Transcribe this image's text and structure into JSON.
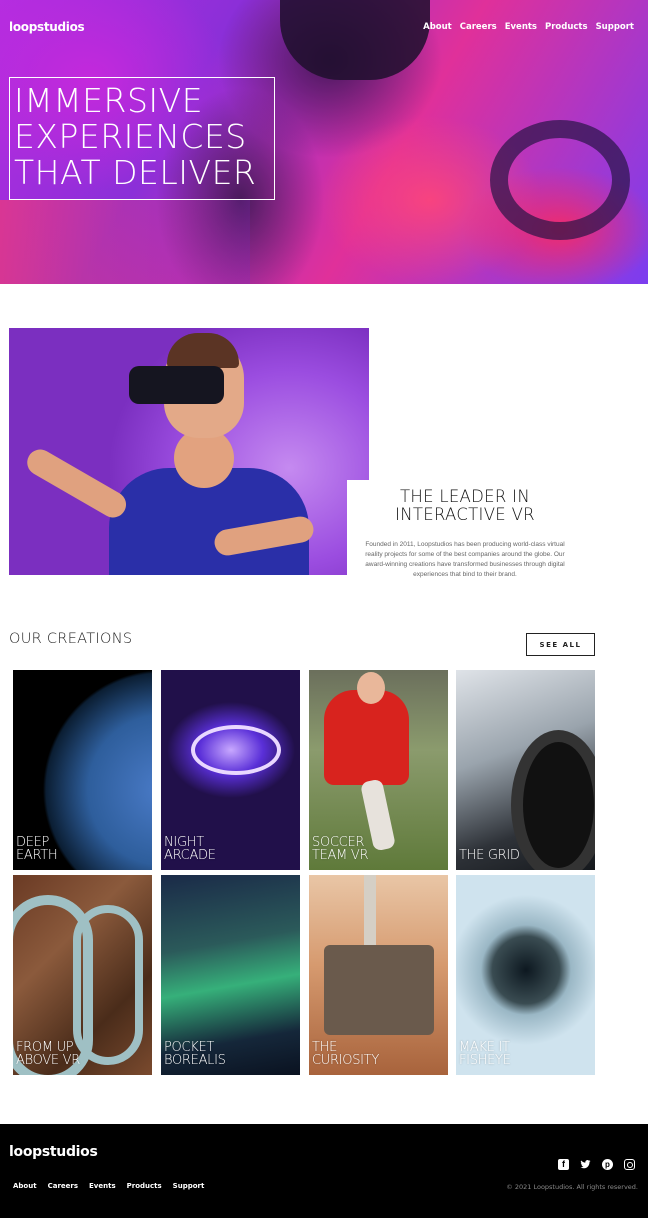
{
  "brand": {
    "logo": "loopstudios"
  },
  "nav": [
    "About",
    "Careers",
    "Events",
    "Products",
    "Support"
  ],
  "hero": {
    "title": "IMMERSIVE\nEXPERIENCES\nTHAT DELIVER"
  },
  "intro": {
    "heading": "THE LEADER IN\nINTERACTIVE VR",
    "text": "Founded in 2011, Loopstudios has been producing world-class virtual reality projects for some of the best companies around the globe. Our award-winning creations have transformed businesses through digital experiences that bind to their brand."
  },
  "creations": {
    "title": "OUR CREATIONS",
    "see_all": "SEE ALL",
    "items": [
      {
        "label": "DEEP\nEARTH"
      },
      {
        "label": "NIGHT\nARCADE"
      },
      {
        "label": "SOCCER\nTEAM VR"
      },
      {
        "label": "THE GRID"
      },
      {
        "label": "FROM UP\nABOVE VR"
      },
      {
        "label": "POCKET\nBOREALIS"
      },
      {
        "label": "THE\nCURIOSITY"
      },
      {
        "label": "MAKE IT\nFISHEYE"
      }
    ]
  },
  "footer": {
    "logo": "loopstudios",
    "nav": [
      "About",
      "Careers",
      "Events",
      "Products",
      "Support"
    ],
    "social": [
      "facebook-icon",
      "twitter-icon",
      "pinterest-icon",
      "instagram-icon"
    ],
    "copyright": "© 2021 Loopstudios. All rights reserved."
  }
}
